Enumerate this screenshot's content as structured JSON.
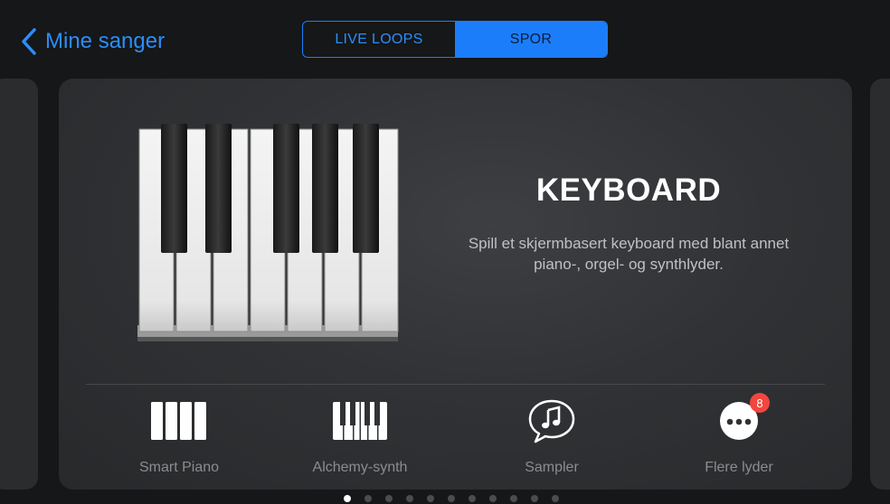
{
  "topbar": {
    "back_label": "Mine sanger",
    "segments": [
      {
        "label": "LIVE LOOPS",
        "active": false
      },
      {
        "label": "SPOR",
        "active": true
      }
    ]
  },
  "card": {
    "title": "KEYBOARD",
    "description": "Spill et skjermbasert keyboard med blant annet piano-, orgel- og synthlyder."
  },
  "instruments": [
    {
      "label": "Smart Piano",
      "icon": "smart-piano-icon"
    },
    {
      "label": "Alchemy-synth",
      "icon": "alchemy-synth-icon"
    },
    {
      "label": "Sampler",
      "icon": "sampler-icon"
    },
    {
      "label": "Flere lyder",
      "icon": "more-sounds-icon",
      "badge": "8"
    }
  ],
  "pager": {
    "count": 11,
    "active_index": 0
  },
  "colors": {
    "accent": "#1c7dfb",
    "background": "#151718",
    "card": "#303235",
    "badge": "#f2463f"
  }
}
